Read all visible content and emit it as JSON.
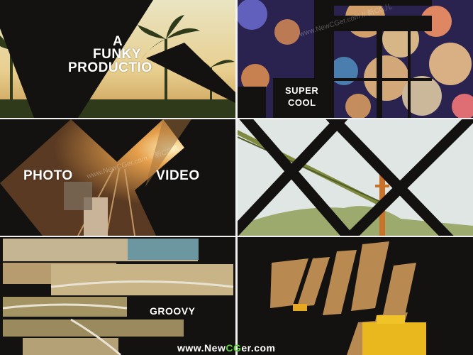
{
  "panels": {
    "p1": {
      "line1": "A",
      "line2": "FUNKY",
      "line3": "PRODUCTIO"
    },
    "p2": {
      "line1": "SUPER",
      "line2": "COOL"
    },
    "p3": {
      "left": "PHOTO",
      "right": "VIDEO"
    },
    "p5": {
      "label": "GROOVY"
    }
  },
  "watermark": {
    "text": "www.NewCGer.com // 新CG儿",
    "footer_prefix": "www.",
    "footer_brand_1": "New",
    "footer_brand_2": "CG",
    "footer_brand_3": "er",
    "footer_suffix": ".com"
  },
  "colors": {
    "frame": "#141210",
    "divider": "#f2f2f2",
    "text": "#ffffff",
    "brand_green": "#5bd13a"
  }
}
